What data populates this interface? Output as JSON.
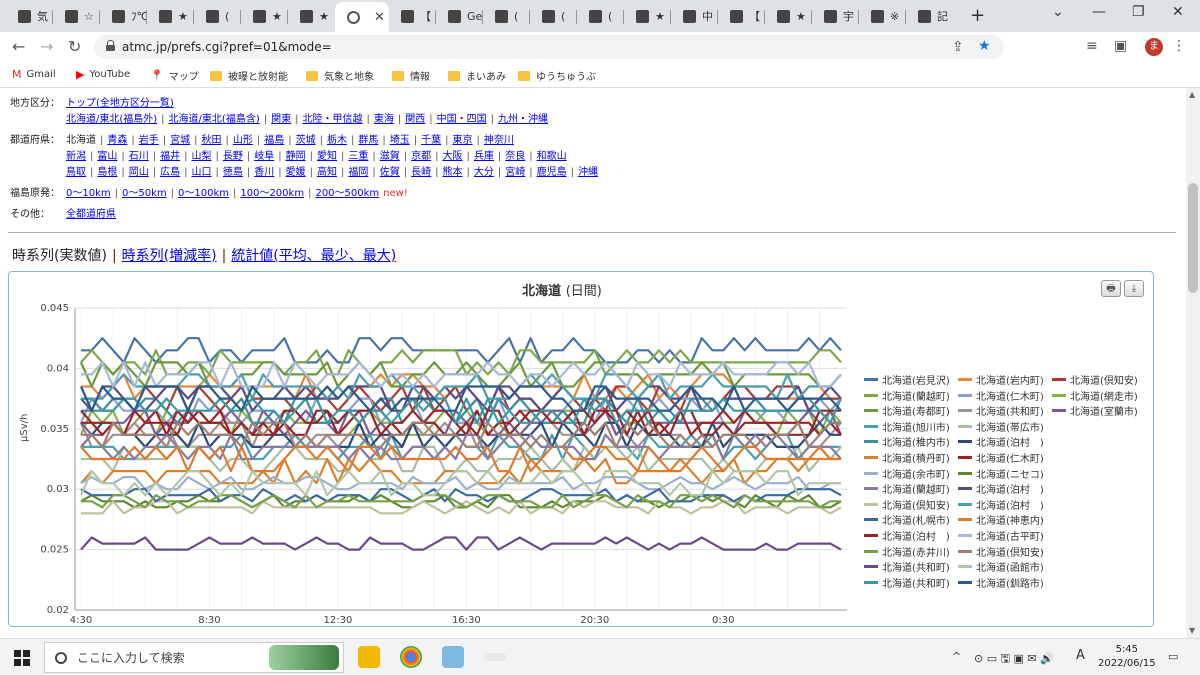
{
  "tabs": [
    {
      "label": "気"
    },
    {
      "label": "☆"
    },
    {
      "label": "ﾌ℃"
    },
    {
      "label": "★"
    },
    {
      "label": "("
    },
    {
      "label": "★"
    },
    {
      "label": "★"
    },
    {
      "label": "",
      "active": true
    },
    {
      "label": "【"
    },
    {
      "label": "Ge"
    },
    {
      "label": "("
    },
    {
      "label": "("
    },
    {
      "label": "("
    },
    {
      "label": "★"
    },
    {
      "label": "中"
    },
    {
      "label": "【"
    },
    {
      "label": "★"
    },
    {
      "label": "宇"
    },
    {
      "label": "※"
    },
    {
      "label": "記"
    }
  ],
  "browser": {
    "url": "atmc.jp/prefs.cgi?pref=01&mode=",
    "profile_initial": "ま",
    "new_tab": "+",
    "win_min": "⌄",
    "win_minimize": "—",
    "win_restore": "❐",
    "win_close": "✕"
  },
  "bookmarks": [
    {
      "label": "Gmail",
      "icon": "M",
      "color": "#d93025"
    },
    {
      "label": "YouTube",
      "icon": "▶",
      "color": "#ff0000"
    },
    {
      "label": "マップ",
      "icon": "📍",
      "color": "#34a853"
    },
    {
      "label": "被曝と放射能",
      "folder": true
    },
    {
      "label": "気象と地象",
      "folder": true
    },
    {
      "label": "情報",
      "folder": true
    },
    {
      "label": "まいあみ",
      "folder": true
    },
    {
      "label": "ゆうちゅうぶ",
      "folder": true
    }
  ],
  "nav": {
    "region_label": "地方区分：",
    "region_top": "トップ(全地方区分一覧)",
    "regions": [
      "北海道/東北(福島外)",
      "北海道/東北(福島含)",
      "関東",
      "北陸・甲信越",
      "東海",
      "関西",
      "中国・四国",
      "九州・沖縄"
    ],
    "pref_label": "都道府県：",
    "pref_current": "北海道",
    "prefs_row1": [
      "青森",
      "岩手",
      "宮城",
      "秋田",
      "山形",
      "福島",
      "茨城",
      "栃木",
      "群馬",
      "埼玉",
      "千葉",
      "東京",
      "神奈川"
    ],
    "prefs_row2": [
      "新潟",
      "富山",
      "石川",
      "福井",
      "山梨",
      "長野",
      "岐阜",
      "静岡",
      "愛知",
      "三重",
      "滋賀",
      "京都",
      "大阪",
      "兵庫",
      "奈良",
      "和歌山"
    ],
    "prefs_row3": [
      "鳥取",
      "島根",
      "岡山",
      "広島",
      "山口",
      "徳島",
      "香川",
      "愛媛",
      "高知",
      "福岡",
      "佐賀",
      "長崎",
      "熊本",
      "大分",
      "宮崎",
      "鹿児島",
      "沖縄"
    ],
    "fukushima_label": "福島原発：",
    "fukushima": [
      "0〜10km",
      "0〜50km",
      "0〜100km",
      "100〜200km",
      "200〜500km"
    ],
    "new_badge": "new!",
    "other_label": "その他：",
    "other": "全都道府県"
  },
  "view_tabs": {
    "current": "時系列(実数値)",
    "links": [
      "時系列(増減率)",
      "統計値(平均、最少、最大)"
    ]
  },
  "chart_data": {
    "type": "line",
    "title": "北海道",
    "subtitle": "(日間)",
    "ylabel": "µSv/h",
    "ylim": [
      0.02,
      0.045
    ],
    "yticks": [
      "0.02",
      "0.025",
      "0.03",
      "0.035",
      "0.04",
      "0.045"
    ],
    "xticks": [
      "4:30",
      "8:30",
      "12:30",
      "16:30",
      "20:30",
      "0:30"
    ],
    "points": 72,
    "series": [
      {
        "name": "北海道(岩見沢)",
        "color": "#4572a7",
        "level": 0.0415,
        "amp": 0.001
      },
      {
        "name": "北海道(岩内町)",
        "color": "#e8863a",
        "level": 0.0385,
        "amp": 0.001
      },
      {
        "name": "北海道(倶知安)",
        "color": "#b03a2e",
        "level": 0.0375,
        "amp": 0.001
      },
      {
        "name": "北海道(蘭越町)",
        "color": "#7da84a",
        "level": 0.0405,
        "amp": 0.001
      },
      {
        "name": "北海道(仁木町)",
        "color": "#8aa0c8",
        "level": 0.0365,
        "amp": 0.001
      },
      {
        "name": "北海道(網走市)",
        "color": "#8ab04a",
        "level": 0.0355,
        "amp": 0.001
      },
      {
        "name": "北海道(寿都町)",
        "color": "#6b9a3a",
        "level": 0.0395,
        "amp": 0.001
      },
      {
        "name": "北海道(共和町)",
        "color": "#a09090",
        "level": 0.0345,
        "amp": 0.001
      },
      {
        "name": "北海道(室蘭市)",
        "color": "#7a5a9a",
        "level": 0.0355,
        "amp": 0.001
      },
      {
        "name": "北海道(旭川市)",
        "color": "#4a9fb0",
        "level": 0.0335,
        "amp": 0.001
      },
      {
        "name": "北海道(帯広市)",
        "color": "#a7c0a0",
        "level": 0.0325,
        "amp": 0.001
      },
      {
        "name": "北海道(稚内市)",
        "color": "#3a8fa0",
        "level": 0.0365,
        "amp": 0.001
      },
      {
        "name": "北海道(泊村　)",
        "color": "#2a4a7a",
        "level": 0.0345,
        "amp": 0.001
      },
      {
        "name": "北海道(積丹町)",
        "color": "#d9822b",
        "level": 0.0315,
        "amp": 0.001
      },
      {
        "name": "北海道(仁木町)",
        "color": "#a02020",
        "level": 0.0355,
        "amp": 0.001
      },
      {
        "name": "北海道(余市町)",
        "color": "#9ab0d0",
        "level": 0.0305,
        "amp": 0.0005
      },
      {
        "name": "北海道(ニセコ)",
        "color": "#5a8a2a",
        "level": 0.029,
        "amp": 0.0005
      },
      {
        "name": "北海道(蘭越町)",
        "color": "#8a7aa0",
        "level": 0.0335,
        "amp": 0.001
      },
      {
        "name": "北海道(泊村　)",
        "color": "#5a4a8a",
        "level": 0.0375,
        "amp": 0.001
      },
      {
        "name": "北海道(倶知安)",
        "color": "#c0c0a0",
        "level": 0.0285,
        "amp": 0.0005
      },
      {
        "name": "北海道(泊村　)",
        "color": "#4aa0b0",
        "level": 0.0385,
        "amp": 0.001
      },
      {
        "name": "北海道(札幌市)",
        "color": "#3a6aa0",
        "level": 0.0295,
        "amp": 0.0005
      },
      {
        "name": "北海道(神恵内)",
        "color": "#e07a30",
        "level": 0.0325,
        "amp": 0.001
      },
      {
        "name": "北海道(泊村　)",
        "color": "#902828",
        "level": 0.0355,
        "amp": 0.001
      },
      {
        "name": "北海道(古平町)",
        "color": "#a8b8d8",
        "level": 0.0395,
        "amp": 0.001
      },
      {
        "name": "北海道(赤井川)",
        "color": "#78a048",
        "level": 0.029,
        "amp": 0.0005
      },
      {
        "name": "北海道(倶知安)",
        "color": "#a08070",
        "level": 0.0345,
        "amp": 0.001
      },
      {
        "name": "北海道(共和町)",
        "color": "#6a4a8a",
        "level": 0.0255,
        "amp": 0.0005
      },
      {
        "name": "北海道(函館市)",
        "color": "#b0c8a8",
        "level": 0.0305,
        "amp": 0.001
      },
      {
        "name": "北海道(共和町)",
        "color": "#3a9aa8",
        "level": 0.0365,
        "amp": 0.001
      },
      {
        "name": "北海道(釧路市)",
        "color": "#2a5a8a",
        "level": 0.0375,
        "amp": 0.001
      }
    ]
  },
  "chart_buttons": {
    "print": "🖶",
    "download": "⤓"
  },
  "taskbar": {
    "search_placeholder": "ここに入力して検索",
    "time": "5:45",
    "date": "2022/06/15",
    "ime": "A",
    "tray_up": "^"
  }
}
